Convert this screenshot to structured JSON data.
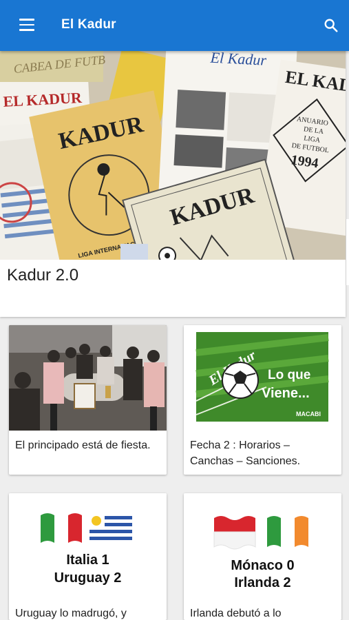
{
  "appbar": {
    "title": "El Kadur",
    "menu_icon": "hamburger-menu-icon",
    "search_icon": "search-icon",
    "color": "#1976d2"
  },
  "featured": {
    "title": "Kadur 2.0",
    "image_texts": {
      "cover_main": "KADUR",
      "cover_bottom": "KADUR",
      "cover_right": "EL KADUR",
      "yearbook_lines": [
        "ANUARIO",
        "DE LA",
        "LIGA",
        "DE FUTBOL",
        "1994"
      ],
      "cover_left": "EL KADUR",
      "cover_top": "El Kadur",
      "rim_text": "LIGA INTERNA FACABEA DE FUTBOL",
      "faint_left": "CABEA DE FUTB"
    }
  },
  "posts": [
    {
      "title": "El principado está de fiesta."
    },
    {
      "title": "Fecha 2 : Horarios – Canchas – Sanciones.",
      "image_texts": {
        "brand": "El Kadur",
        "headline_1": "Lo que",
        "headline_2": "Viene...",
        "logo": "MACABI"
      }
    },
    {
      "title": "Uruguay lo madrugó, y",
      "score_lines": [
        "Italia 1",
        "Uruguay 2"
      ]
    },
    {
      "title": "Irlanda debutó a lo",
      "score_lines": [
        "Mónaco 0",
        "Irlanda 2"
      ]
    }
  ]
}
